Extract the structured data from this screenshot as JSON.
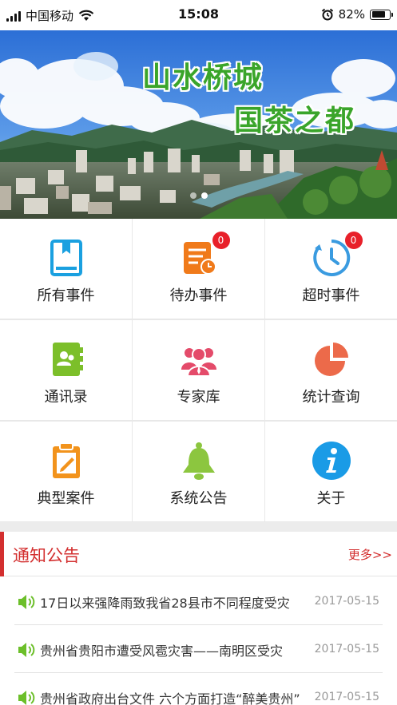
{
  "status_bar": {
    "carrier": "中国移动",
    "time": "15:08",
    "battery": "82%",
    "battery_level": 0.82,
    "icons": [
      "signal-icon",
      "wifi-icon",
      "alarm-icon",
      "battery-icon"
    ]
  },
  "banner": {
    "line1": "山水桥城",
    "line2": "国茶之都",
    "slide_count": 2,
    "active_slide": 1
  },
  "menu": [
    {
      "label": "所有事件",
      "icon": "book-icon",
      "color": "#1aa0e0"
    },
    {
      "label": "待办事件",
      "icon": "todo-list-icon",
      "color": "#f07a1a",
      "badge": "0"
    },
    {
      "label": "超时事件",
      "icon": "clock-icon",
      "color": "#3a9be0",
      "badge": "0"
    },
    {
      "label": "通讯录",
      "icon": "contacts-icon",
      "color": "#7cbf2a"
    },
    {
      "label": "专家库",
      "icon": "experts-icon",
      "color": "#e44b6a"
    },
    {
      "label": "统计查询",
      "icon": "pie-chart-icon",
      "color": "#ec6a4a"
    },
    {
      "label": "典型案件",
      "icon": "clipboard-icon",
      "color": "#f2931c"
    },
    {
      "label": "系统公告",
      "icon": "bell-icon",
      "color": "#8cc63f"
    },
    {
      "label": "关于",
      "icon": "info-icon",
      "color": "#1a9be6"
    }
  ],
  "notice": {
    "title": "通知公告",
    "more": "更多>>",
    "items": [
      {
        "title": "17日以来强降雨致我省28县市不同程度受灾",
        "date": "2017-05-15"
      },
      {
        "title": "贵州省贵阳市遭受风雹灾害——南明区受灾",
        "date": "2017-05-15"
      },
      {
        "title": "贵州省政府出台文件 六个方面打造“醉美贵州”",
        "date": "2017-05-15"
      }
    ]
  }
}
